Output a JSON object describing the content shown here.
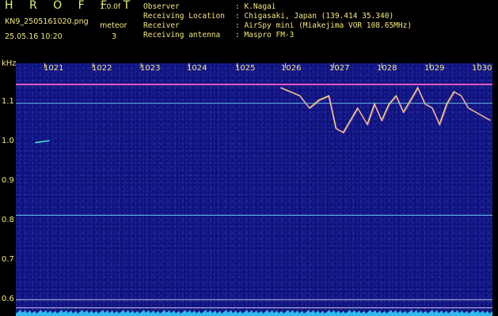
{
  "header": {
    "brand": "H R O F F T",
    "version": "1.0.0f",
    "filename": "KN9_2505161020.png",
    "datetime": "25.05.16 10:20",
    "meteor_label": "meteor",
    "meteor_count": "3"
  },
  "info": [
    {
      "label": "Observer",
      "value": ": K.Nagai"
    },
    {
      "label": "Receiving Location",
      "value": ": Chigasaki, Japan (139.414 35.340)"
    },
    {
      "label": "Receiver",
      "value": ": AirSpy mini (Miakejima VOR 108.65MHz)"
    },
    {
      "label": "Receiving antenna",
      "value": ": Maspro FM-3"
    }
  ],
  "colors": {
    "background": "#000000",
    "plot_bg": "#11127a",
    "text": "#f5e77a",
    "carrier": "#ff66cc",
    "echo": "#f0e07a",
    "noise_floor": "#33d6ff"
  },
  "chart_data": {
    "type": "heatmap",
    "ylabel": "kHz",
    "x_ticks": [
      "1021",
      "1022",
      "1023",
      "1024",
      "1025",
      "1026",
      "1027",
      "1028",
      "1029",
      "1030"
    ],
    "y_ticks": [
      "1.1",
      "1.0",
      "0.9",
      "0.8",
      "0.7",
      "0.6"
    ],
    "ylim": [
      0.58,
      1.2
    ],
    "xlim": [
      1020.4,
      1030.3
    ],
    "horizontal_lines_khz": [
      1.148,
      1.102,
      0.827,
      0.62,
      0.6
    ],
    "echo_trace": {
      "x": [
        1025.9,
        1026.1,
        1026.3,
        1026.5,
        1026.7,
        1026.9,
        1027.05,
        1027.2,
        1027.35,
        1027.5,
        1027.7,
        1027.85,
        1028.0,
        1028.15,
        1028.3,
        1028.45,
        1028.6,
        1028.75,
        1028.9,
        1029.05,
        1029.2,
        1029.35,
        1029.5,
        1029.65,
        1029.8,
        1029.95,
        1030.1,
        1030.25
      ],
      "y": [
        1.14,
        1.13,
        1.12,
        1.09,
        1.11,
        1.12,
        1.04,
        1.03,
        1.06,
        1.09,
        1.05,
        1.1,
        1.06,
        1.1,
        1.12,
        1.08,
        1.11,
        1.14,
        1.1,
        1.09,
        1.05,
        1.1,
        1.13,
        1.12,
        1.09,
        1.08,
        1.07,
        1.06
      ]
    },
    "meteor_streak": {
      "x": [
        1020.8,
        1021.1
      ],
      "y": [
        1.005,
        1.01
      ]
    }
  }
}
